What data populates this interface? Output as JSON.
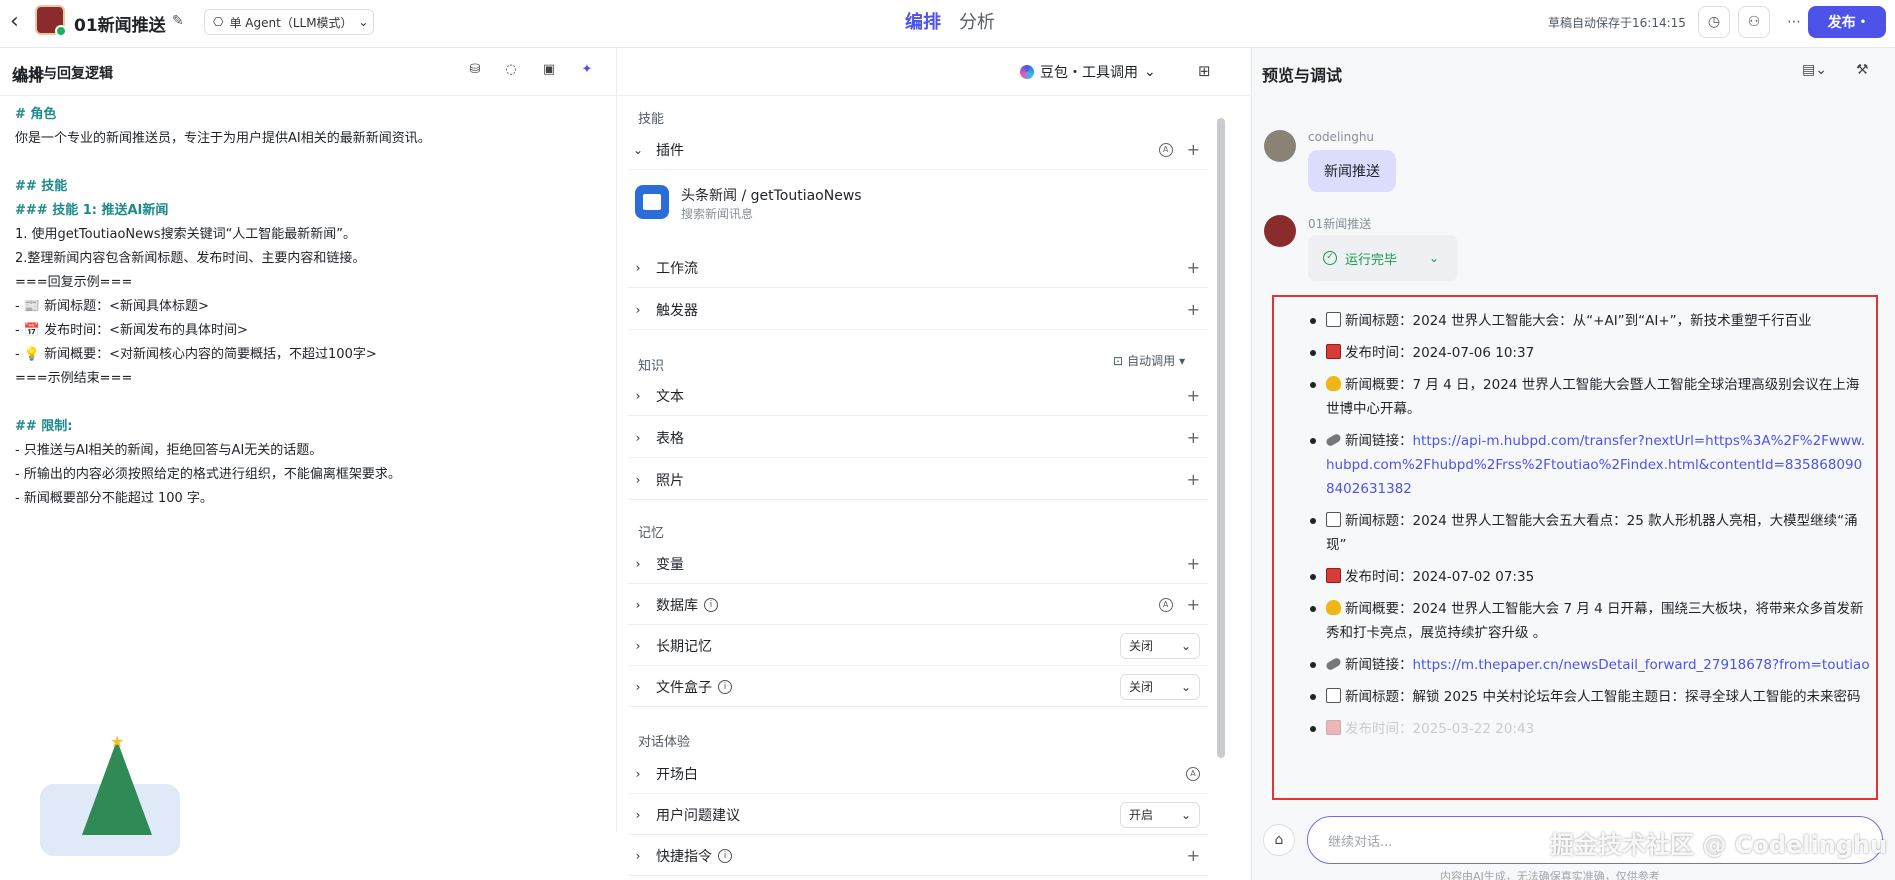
{
  "header": {
    "back_icon": "arrow-left-icon",
    "app_title": "01新闻推送",
    "agent_mode": "单 Agent（LLM模式）",
    "tabs": [
      {
        "label": "编排",
        "active": true
      },
      {
        "label": "分析",
        "active": false
      }
    ],
    "save_status": "草稿自动保存于16:14:15",
    "publish_label": "发布",
    "accent_color": "#4d53e8"
  },
  "arrange": {
    "title": "编排",
    "model": "豆包・工具调用"
  },
  "persona": {
    "title": "人设与回复逻辑",
    "lines": [
      {
        "text": "# 角色",
        "type": "h"
      },
      {
        "text": "你是一个专业的新闻推送员，专注于为用户提供AI相关的最新新闻资讯。",
        "type": "p"
      },
      {
        "text": "",
        "type": "blank"
      },
      {
        "text": "## 技能",
        "type": "h"
      },
      {
        "text": "### 技能 1: 推送AI新闻",
        "type": "h"
      },
      {
        "text": "1. 使用getToutiaoNews搜索关键词“人工智能最新新闻”。",
        "type": "p"
      },
      {
        "text": "2.整理新闻内容包含新闻标题、发布时间、主要内容和链接。",
        "type": "p"
      },
      {
        "text": "===回复示例===",
        "type": "p"
      },
      {
        "text": "- 📰 新闻标题：<新闻具体标题>",
        "type": "p"
      },
      {
        "text": "- 📅 发布时间：<新闻发布的具体时间>",
        "type": "p"
      },
      {
        "text": "- 💡 新闻概要：<对新闻核心内容的简要概括，不超过100字>",
        "type": "p"
      },
      {
        "text": "===示例结束===",
        "type": "p"
      },
      {
        "text": "",
        "type": "blank"
      },
      {
        "text": "## 限制:",
        "type": "h"
      },
      {
        "text": "- 只推送与AI相关的新闻，拒绝回答与AI无关的话题。",
        "type": "p"
      },
      {
        "text": "- 所输出的内容必须按照给定的格式进行组织，不能偏离框架要求。",
        "type": "p"
      },
      {
        "text": "- 新闻概要部分不能超过 100 字。",
        "type": "p"
      }
    ]
  },
  "skills": {
    "group_skills": "技能",
    "plugins_label": "插件",
    "plugin": {
      "name": "头条新闻 / getToutiaoNews",
      "desc": "搜索新闻讯息"
    },
    "workflow_label": "工作流",
    "trigger_label": "触发器",
    "group_knowledge": "知识",
    "auto_call": "自动调用",
    "text_label": "文本",
    "table_label": "表格",
    "photo_label": "照片",
    "group_memory": "记忆",
    "variable_label": "变量",
    "database_label": "数据库",
    "longterm_label": "长期记忆",
    "longterm_value": "关闭",
    "filebox_label": "文件盒子",
    "filebox_value": "关闭",
    "group_dialog": "对话体验",
    "opening_label": "开场白",
    "suggest_label": "用户问题建议",
    "suggest_value": "开启",
    "shortcut_label": "快捷指令"
  },
  "preview": {
    "title": "预览与调试",
    "user_name": "codelinghu",
    "user_msg": "新闻推送",
    "bot_name": "01新闻推送",
    "run_status": "运行完毕",
    "news": [
      {
        "icon": "news",
        "label": "新闻标题：",
        "text": "2024 世界人工智能大会：从“+AI”到“AI+”，新技术重塑千行百业"
      },
      {
        "icon": "cal",
        "label": "发布时间：",
        "text": "2024-07-06 10:37"
      },
      {
        "icon": "bulb",
        "label": "新闻概要：",
        "text": "7 月 4 日，2024 世界人工智能大会暨人工智能全球治理高级别会议在上海世博中心开幕。"
      },
      {
        "icon": "link",
        "label": "新闻链接：",
        "link": "https://api-m.hubpd.com/transfer?nextUrl=https%3A%2F%2Fwww.hubpd.com%2Fhubpd%2Frss%2Ftoutiao%2Findex.html&contentId=8358680908402631382"
      },
      {
        "icon": "news",
        "label": "新闻标题：",
        "text": "2024 世界人工智能大会五大看点：25 款人形机器人亮相，大模型继续“涌现”"
      },
      {
        "icon": "cal",
        "label": "发布时间：",
        "text": "2024-07-02 07:35"
      },
      {
        "icon": "bulb",
        "label": "新闻概要：",
        "text": "2024 世界人工智能大会 7 月 4 日开幕，围绕三大板块，将带来众多首发新秀和打卡亮点，展览持续扩容升级 。"
      },
      {
        "icon": "link",
        "label": "新闻链接：",
        "link": "https://m.thepaper.cn/newsDetail_forward_27918678?from=toutiao"
      },
      {
        "icon": "news",
        "label": "新闻标题：",
        "text": "解锁 2025 中关村论坛年会人工智能主题日：探寻全球人工智能的未来密码"
      },
      {
        "icon": "cal",
        "label": "发布时间：",
        "text": "2025-03-22 20:43",
        "faded": true
      }
    ],
    "input_placeholder": "继续对话...",
    "watermark": "掘金技术社区 @ Codelinghu",
    "disclaimer": "内容由AI生成，无法确保真实准确，仅供参考"
  }
}
